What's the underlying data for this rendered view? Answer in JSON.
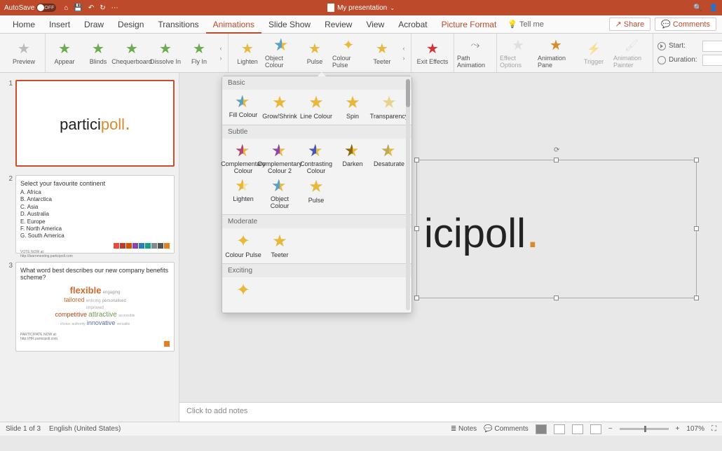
{
  "titlebar": {
    "autosave": "AutoSave",
    "doc_title": "My presentation"
  },
  "tabs": {
    "home": "Home",
    "insert": "Insert",
    "draw": "Draw",
    "design": "Design",
    "transitions": "Transitions",
    "animations": "Animations",
    "slideshow": "Slide Show",
    "review": "Review",
    "view": "View",
    "acrobat": "Acrobat",
    "picfmt": "Picture Format",
    "tellme": "Tell me",
    "share": "Share",
    "comments": "Comments"
  },
  "ribbon": {
    "preview": "Preview",
    "entrance": [
      "Appear",
      "Blinds",
      "Chequerboard",
      "Dissolve In",
      "Fly In"
    ],
    "emphasis": [
      "Lighten",
      "Object Colour",
      "Pulse",
      "Colour Pulse",
      "Teeter"
    ],
    "exit": "Exit Effects",
    "path": "Path Animation",
    "effopt": "Effect Options",
    "pane": "Animation Pane",
    "trigger": "Trigger",
    "painter": "Animation Painter",
    "start": "Start:",
    "duration": "Duration:"
  },
  "dropdown": {
    "basic": "Basic",
    "basic_items": [
      "Fill Colour",
      "Grow/Shrink",
      "Line Colour",
      "Spin",
      "Transparency"
    ],
    "subtle": "Subtle",
    "subtle_items": [
      "Complementary Colour",
      "Complementary Colour 2",
      "Contrasting Colour",
      "Darken",
      "Desaturate",
      "Lighten",
      "Object Colour",
      "Pulse"
    ],
    "moderate": "Moderate",
    "moderate_items": [
      "Colour Pulse",
      "Teeter"
    ],
    "exciting": "Exciting"
  },
  "thumbs": {
    "s2_title": "Select your favourite continent",
    "s2_items": [
      "A.  Africa",
      "B.  Antarctica",
      "C.  Asia",
      "D.  Australia",
      "E.  Europe",
      "F.  North America",
      "G.  South America"
    ],
    "s3_title": "What word best describes our new company benefits scheme?",
    "cloud": {
      "flexible": "flexible",
      "tailored": "tailored",
      "competitive": "competitive",
      "attractive": "attractive",
      "innovative": "innovative",
      "engaging": "engaging",
      "personalised": "personalised",
      "improved": "improved",
      "accessible": "accessible",
      "choice": "choice",
      "authority": "authority",
      "versatile": "versatile",
      "enticing": "enticing"
    },
    "vote": "VOTE NOW at:"
  },
  "logo": {
    "p1": "partici",
    "p2": "poll",
    "canvas": "icipoll"
  },
  "notes": "Click to add notes",
  "status": {
    "pos": "Slide 1 of 3",
    "lang": "English (United States)",
    "notes": "Notes",
    "comments": "Comments",
    "zoom": "107%"
  }
}
